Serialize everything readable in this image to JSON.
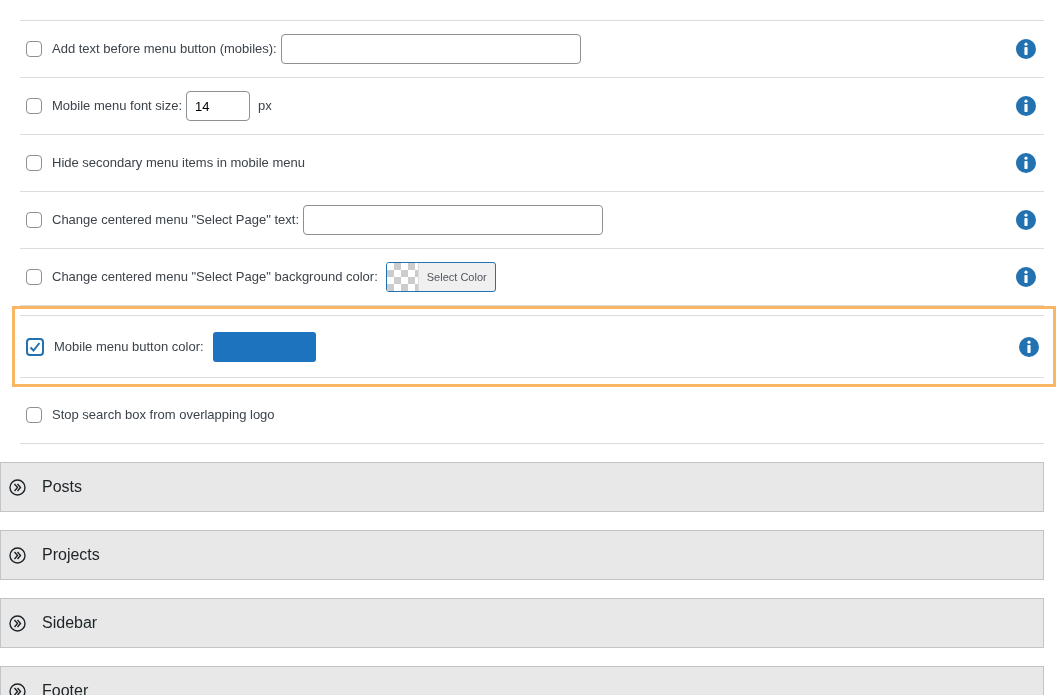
{
  "options": [
    {
      "kind": "text",
      "label": "Add text before menu button (mobiles):",
      "checked": false,
      "highlighted": false,
      "info": true
    },
    {
      "kind": "number",
      "label": "Mobile menu font size:",
      "checked": false,
      "value": "14",
      "unit": "px",
      "highlighted": false,
      "info": true
    },
    {
      "kind": "plain",
      "label": "Hide secondary menu items in mobile menu",
      "checked": false,
      "highlighted": false,
      "info": true
    },
    {
      "kind": "text",
      "label": "Change centered menu \"Select Page\" text:",
      "checked": false,
      "highlighted": false,
      "info": true
    },
    {
      "kind": "color",
      "label": "Change centered menu \"Select Page\" background color:",
      "checked": false,
      "button": "Select Color",
      "highlighted": false,
      "info": true
    },
    {
      "kind": "color",
      "label": "Mobile menu button color:",
      "checked": true,
      "color": "#1e73be",
      "highlighted": true,
      "info": true
    },
    {
      "kind": "plain",
      "label": "Stop search box from overlapping logo",
      "checked": false,
      "highlighted": false,
      "info": false
    }
  ],
  "sections": [
    {
      "title": "Posts"
    },
    {
      "title": "Projects"
    },
    {
      "title": "Sidebar"
    },
    {
      "title": "Footer"
    }
  ]
}
